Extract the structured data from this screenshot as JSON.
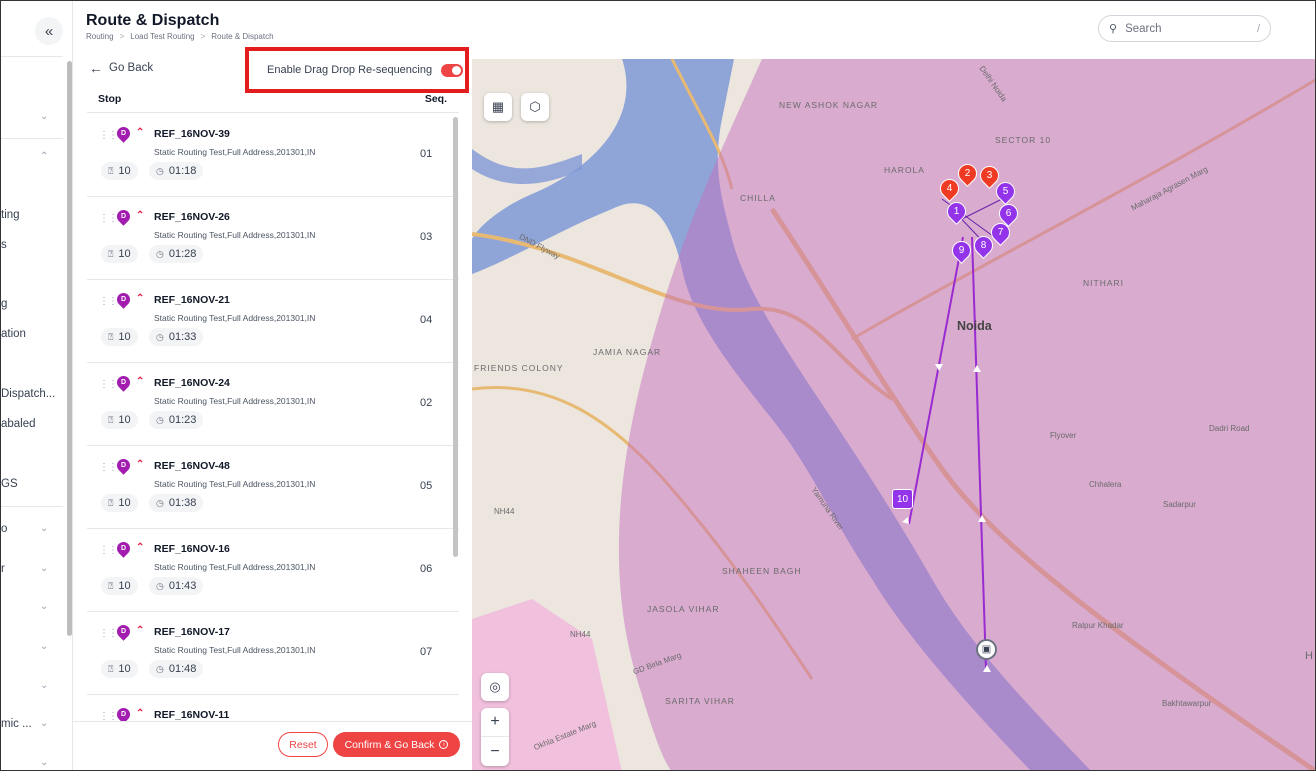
{
  "nav": {
    "collapse_icon": "«",
    "items": [
      "ting",
      "s",
      "g",
      "ation",
      "Dispatch...",
      "abaled",
      "GS",
      "o",
      "r",
      "mic ..."
    ]
  },
  "header": {
    "title": "Route & Dispatch",
    "breadcrumb": [
      "Routing",
      "Load Test Routing",
      "Route & Dispatch"
    ],
    "search_placeholder": "Search",
    "search_shortcut": "/"
  },
  "panel": {
    "go_back": "Go Back",
    "toggle_label": "Enable Drag Drop Re-sequencing",
    "toggle_on": true,
    "col_stop": "Stop",
    "col_seq": "Seq.",
    "pin_letter": "D",
    "stops": [
      {
        "ref": "REF_16NOV-39",
        "address": "Static Routing Test,Full Address,201301,IN",
        "seq": "01",
        "qty": "10",
        "time": "01:18"
      },
      {
        "ref": "REF_16NOV-26",
        "address": "Static Routing Test,Full Address,201301,IN",
        "seq": "03",
        "qty": "10",
        "time": "01:28"
      },
      {
        "ref": "REF_16NOV-21",
        "address": "Static Routing Test,Full Address,201301,IN",
        "seq": "04",
        "qty": "10",
        "time": "01:33"
      },
      {
        "ref": "REF_16NOV-24",
        "address": "Static Routing Test,Full Address,201301,IN",
        "seq": "02",
        "qty": "10",
        "time": "01:23"
      },
      {
        "ref": "REF_16NOV-48",
        "address": "Static Routing Test,Full Address,201301,IN",
        "seq": "05",
        "qty": "10",
        "time": "01:38"
      },
      {
        "ref": "REF_16NOV-16",
        "address": "Static Routing Test,Full Address,201301,IN",
        "seq": "06",
        "qty": "10",
        "time": "01:43"
      },
      {
        "ref": "REF_16NOV-17",
        "address": "Static Routing Test,Full Address,201301,IN",
        "seq": "07",
        "qty": "10",
        "time": "01:48"
      },
      {
        "ref": "REF_16NOV-11",
        "address": "",
        "seq": "",
        "qty": "",
        "time": ""
      }
    ],
    "reset_label": "Reset",
    "confirm_label": "Confirm & Go Back"
  },
  "map": {
    "labels": {
      "new_ashok_nagar": "NEW ASHOK NAGAR",
      "sector10": "SECTOR 10",
      "harola": "HAROLA",
      "chilla": "CHILLA",
      "nithari": "NITHARI",
      "noida": "Noida",
      "jamia_nagar": "JAMIA NAGAR",
      "friends_colony": "FRIENDS COLONY",
      "shaheen_bagh": "SHAHEEN BAGH",
      "jasola_vihar": "JASOLA VIHAR",
      "sarita_vihar": "SARITA VIHAR",
      "dadri_road": "Dadri Road",
      "chhalera": "Chhalera",
      "sadarpur": "Sadarpur",
      "ralpur_khadar": "Ralpur Khadar",
      "bakhtawarpur": "Bakhtawarpur",
      "flyover": "Flyover",
      "nh44_a": "NH44",
      "nh44_b": "NH44",
      "dnd_flyway": "DND Flyway",
      "gd_birla_marg": "GD Birla Marg",
      "okhla_estate_marg": "Okhla Estate Marg",
      "yamuna_river": "Yamuna River",
      "delhi_noida": "Delhi Noida",
      "agrasen": "Maharaja Agrasen Marg",
      "h": "H"
    },
    "markers": {
      "m1": "1",
      "m2": "2",
      "m3": "3",
      "m4": "4",
      "m5": "5",
      "m6": "6",
      "m7": "7",
      "m8": "8",
      "m9": "9",
      "m10": "10"
    },
    "overlay_color": "#c46fc0",
    "route_color": "#9a2ad1",
    "accent": "#ef4444"
  }
}
